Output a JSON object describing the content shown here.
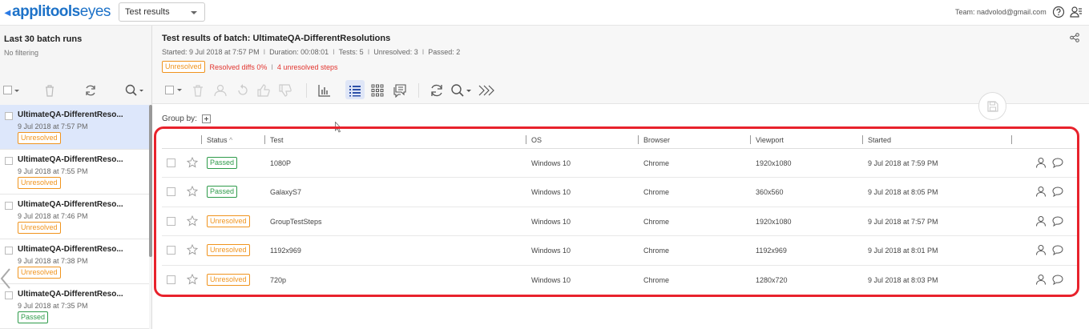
{
  "app": {
    "logo_mark": "◂",
    "logo_brand": "applitools",
    "logo_product": "eyes",
    "view_selector": "Test results",
    "team": "Team: nadvolod@gmail.com"
  },
  "left_panel": {
    "title": "Last 30 batch runs",
    "filter": "No filtering",
    "batches": [
      {
        "name": "UltimateQA-DifferentReso...",
        "date": "9 Jul 2018 at 7:57 PM",
        "status": "Unresolved",
        "selected": true
      },
      {
        "name": "UltimateQA-DifferentReso...",
        "date": "9 Jul 2018 at 7:55 PM",
        "status": "Unresolved"
      },
      {
        "name": "UltimateQA-DifferentReso...",
        "date": "9 Jul 2018 at 7:46 PM",
        "status": "Unresolved"
      },
      {
        "name": "UltimateQA-DifferentReso...",
        "date": "9 Jul 2018 at 7:38 PM",
        "status": "Unresolved"
      },
      {
        "name": "UltimateQA-DifferentReso...",
        "date": "9 Jul 2018 at 7:35 PM",
        "status": "Passed"
      }
    ]
  },
  "header": {
    "title": "Test results of batch: UltimateQA-DifferentResolutions",
    "meta": {
      "started": "Started: 9 Jul 2018 at 7:57 PM",
      "duration": "Duration: 00:08:01",
      "tests": "Tests: 5",
      "unresolved": "Unresolved: 3",
      "passed": "Passed: 2"
    },
    "status_badge": "Unresolved",
    "resolved_diffs": "Resolved diffs 0%",
    "unresolved_steps": "4 unresolved steps",
    "separator": "I"
  },
  "group_by": {
    "label": "Group by:"
  },
  "table": {
    "columns": {
      "status": "Status",
      "sort_indicator": "^",
      "test": "Test",
      "os": "OS",
      "browser": "Browser",
      "viewport": "Viewport",
      "started": "Started"
    },
    "rows": [
      {
        "status": "Passed",
        "test": "1080P",
        "os": "Windows 10",
        "browser": "Chrome",
        "viewport": "1920x1080",
        "started": "9 Jul 2018 at 7:59 PM"
      },
      {
        "status": "Passed",
        "test": "GalaxyS7",
        "os": "Windows 10",
        "browser": "Chrome",
        "viewport": "360x560",
        "started": "9 Jul 2018 at 8:05 PM"
      },
      {
        "status": "Unresolved",
        "test": "GroupTestSteps",
        "os": "Windows 10",
        "browser": "Chrome",
        "viewport": "1920x1080",
        "started": "9 Jul 2018 at 7:57 PM"
      },
      {
        "status": "Unresolved",
        "test": "1192x969",
        "os": "Windows 10",
        "browser": "Chrome",
        "viewport": "1192x969",
        "started": "9 Jul 2018 at 8:01 PM"
      },
      {
        "status": "Unresolved",
        "test": "720p",
        "os": "Windows 10",
        "browser": "Chrome",
        "viewport": "1280x720",
        "started": "9 Jul 2018 at 8:03 PM"
      }
    ]
  },
  "colors": {
    "brand": "#1d72c8",
    "passed": "#2e9b4a",
    "unresolved": "#f0941e",
    "alert": "#e2352f",
    "highlight": "#e8222c",
    "selected_row": "#dde7fb"
  },
  "icons": {
    "top_help": "help-icon",
    "top_user_settings": "user-settings-icon",
    "share": "share-icon",
    "row_user": "user-icon",
    "row_comment": "comment-icon",
    "row_star": "star-icon"
  }
}
